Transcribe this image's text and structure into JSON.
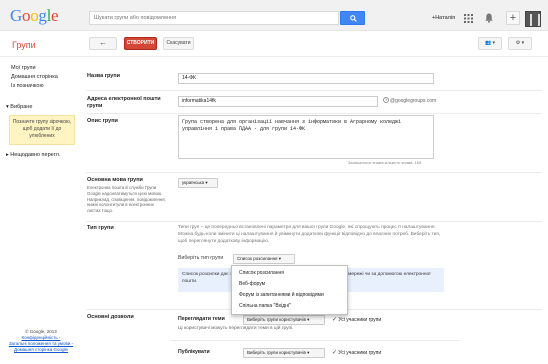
{
  "topbar": {
    "logo_letters": [
      "G",
      "o",
      "o",
      "g",
      "l",
      "e"
    ],
    "search_placeholder": "Шукати групи або повідомлення",
    "user_name": "+Наталія",
    "plus_label": "+"
  },
  "actionbar": {
    "page_title": "Групи",
    "back_label": "←",
    "create_label": "СТВОРИТИ",
    "cancel_label": "Скасувати",
    "members_label": "👥 ▾",
    "settings_label": "⚙ ▾"
  },
  "sidebar": {
    "links": [
      "Мої групи",
      "Домашня сторінка",
      "Із позначкою"
    ],
    "favorites_label": "▾ Вибране",
    "promo_text": "Позначте групу зірочкою, щоб додати її до улюблених",
    "recent_label": "▸ Нещодавно перегл.",
    "footer_copyright": "© Google, 2013",
    "footer_privacy": "Конфіденційність -",
    "footer_terms": "Загальні положення та умови -",
    "footer_home": "Домашня сторінка Google"
  },
  "form": {
    "group_name_label": "Назва групи",
    "group_name_value": "14-ФК",
    "email_label": "Адреса електронної пошти групи",
    "email_value": "informatika14fk",
    "email_domain": "@googlegroups.com",
    "description_label": "Опис групи",
    "description_value": "Група створена для організації навчання з інформатики в Аграрному коледжі управління і права ПДАА - для групи 14-ФК",
    "char_count": "Залишилося знаків кількість знаків: 168",
    "language_label": "Основна мова групи",
    "language_hint": "Електронна пошта й служби Групи Google надсилатимуться цією мовою. Наприклад, сповіщення, повідомлення, нижні колонтитули в електронних листах тощо.",
    "language_value": "українська ▾",
    "type_label": "Тип групи",
    "type_description": "Типи груп – це попередньо встановлені параметри для вашої групи Google, які спрощують процес її налаштування. Можна будь-коли змінити ці налаштування й увімкнути додаткові функції відповідно до власних потреб. Виберіть тип, щоб переглянути додаткову інформацію.",
    "choose_type_label": "Виберіть тип групи",
    "choose_type_value": "Список розсилання ▾",
    "info_text": "Список розсилки дає змогу користувачам надсилати повідомлення групі з мережі чи за допомогою електронної пошти.",
    "dropdown_options": [
      "Список розсилання",
      "Веб-форум",
      "Форум із запитаннями й відповідями",
      "Спільна папка \"Вхідні\""
    ],
    "permissions_label": "Основні дозволи",
    "view_topics_label": "Переглядати теми",
    "view_topics_select": "Виберіть групи користувачів ▾",
    "view_topics_check": "Усі учасники групи",
    "view_topics_hint": "Ці користувачі можуть переглядати теми в цій групі.",
    "publish_label": "Публікувати",
    "publish_select": "Виберіть групи користувачів ▾",
    "publish_check": "Усі учасники групи"
  },
  "colors": {
    "accent_red": "#d14836",
    "google_blue": "#4285f4",
    "promo_bg": "#fff4c2",
    "info_bg": "#e8f0fe"
  }
}
